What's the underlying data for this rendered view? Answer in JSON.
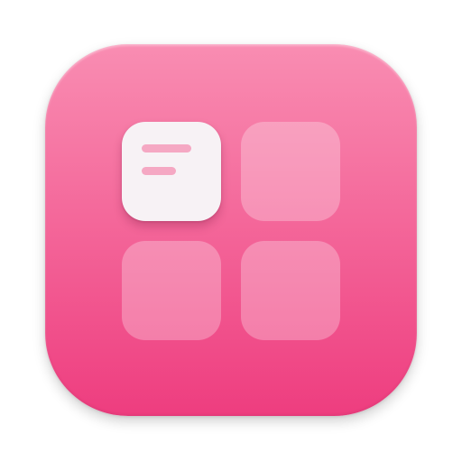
{
  "icon": {
    "name": "app-icon",
    "colors": {
      "background_top": "#f98db2",
      "background_bottom": "#ee3d7f",
      "tile_active": "#f7f2f5",
      "tile_active_lines": "#f5a8c3",
      "tile_inactive": "#ffffff"
    },
    "tiles": [
      {
        "position": "top-left",
        "state": "active",
        "content": "text-lines"
      },
      {
        "position": "top-right",
        "state": "inactive"
      },
      {
        "position": "bottom-left",
        "state": "inactive"
      },
      {
        "position": "bottom-right",
        "state": "inactive"
      }
    ]
  }
}
